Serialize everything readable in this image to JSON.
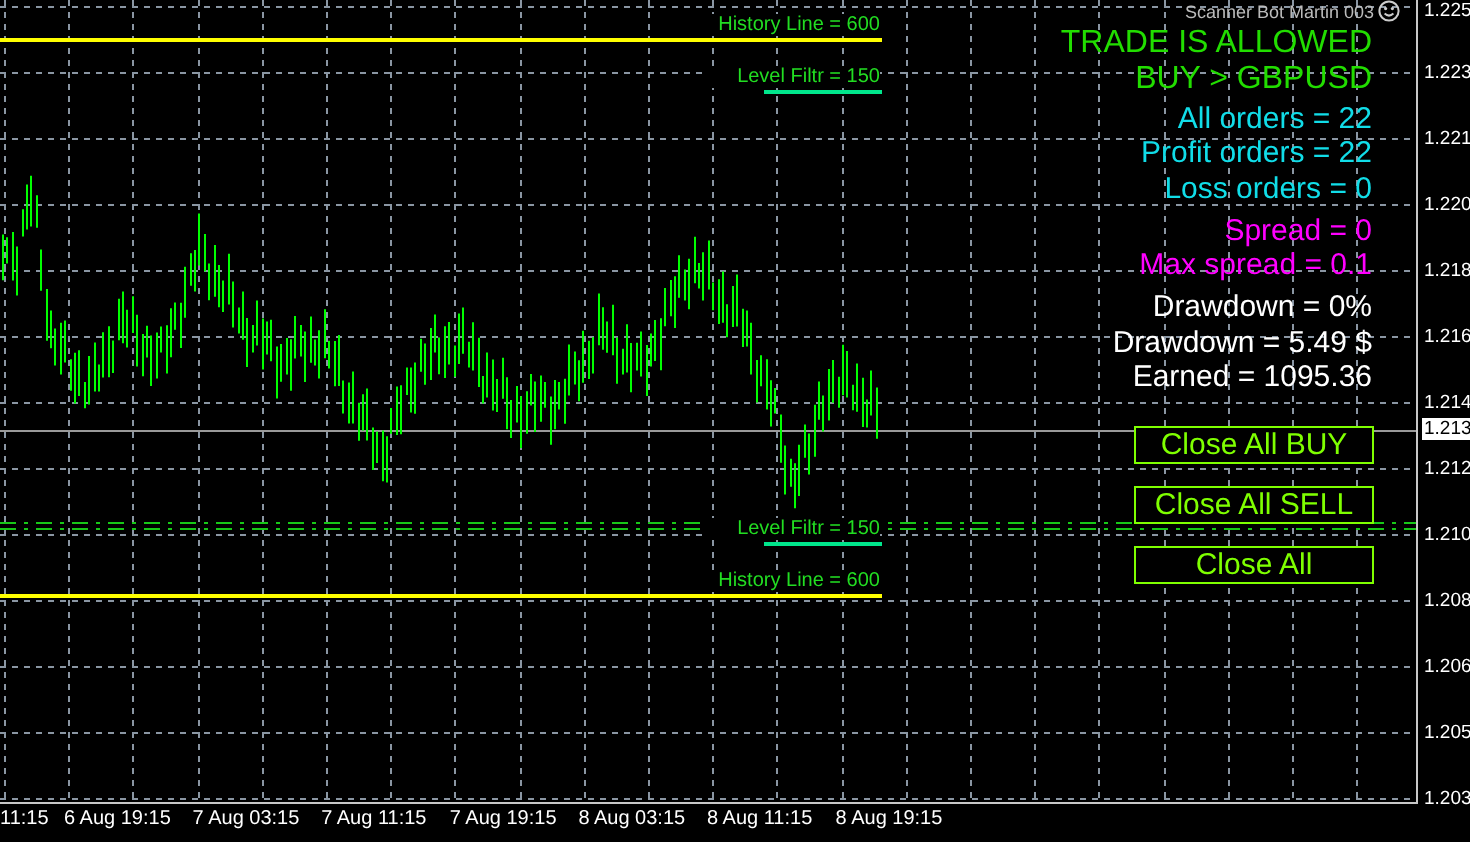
{
  "chart": {
    "indicator_name": "Scanner Bot Martin 003",
    "current_price": "1.213",
    "price_axis": [
      "1.225",
      "1.223",
      "1.221",
      "1.220",
      "1.218",
      "1.216",
      "1.214",
      "1.212",
      "1.210",
      "1.208",
      "1.206",
      "1.205",
      "1.203"
    ],
    "time_axis": [
      "11:15",
      "6 Aug 19:15",
      "7 Aug 03:15",
      "7 Aug 11:15",
      "7 Aug 19:15",
      "8 Aug 03:15",
      "8 Aug 11:15",
      "8 Aug 19:15"
    ]
  },
  "lines": [
    {
      "kind": "history",
      "label": "History Line = 600",
      "color": "#ffff00"
    },
    {
      "kind": "filter",
      "label": "Level Filtr = 150",
      "color": "#00e68c"
    },
    {
      "kind": "filter",
      "label": "Level Filtr = 150",
      "color": "#00e68c"
    },
    {
      "kind": "history",
      "label": "History Line = 600",
      "color": "#ffff00"
    }
  ],
  "info": [
    {
      "kind": "status",
      "text": "TRADE IS ALLOWED"
    },
    {
      "kind": "status",
      "text": "BUY > GBPUSD"
    },
    {
      "kind": "orders",
      "text": "All orders = 22"
    },
    {
      "kind": "orders",
      "text": "Profit orders = 22"
    },
    {
      "kind": "orders",
      "text": "Loss orders = 0"
    },
    {
      "kind": "spread",
      "text": "Spread =  0"
    },
    {
      "kind": "spread",
      "text": "Max spread =  0.1"
    },
    {
      "kind": "account",
      "text": "Drawdown  = 0%"
    },
    {
      "kind": "account",
      "text": "Drawdown = 5.49 $"
    },
    {
      "kind": "account",
      "text": "Earned = 1095.36"
    }
  ],
  "buttons": [
    "Close All BUY",
    "Close All SELL",
    "Close All"
  ]
}
